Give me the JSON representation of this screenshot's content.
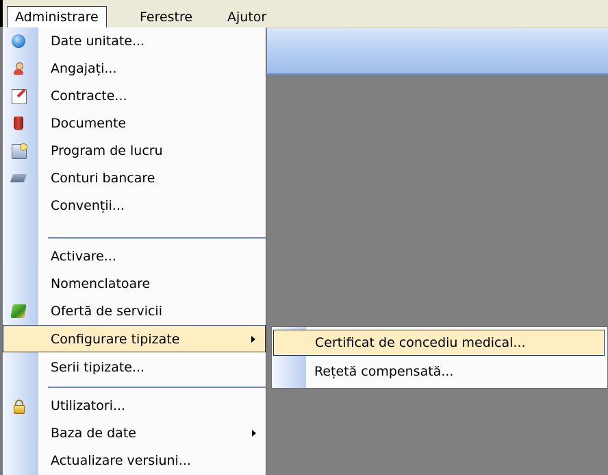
{
  "menubar": {
    "items": [
      {
        "label": "Administrare"
      },
      {
        "label": "Ferestre"
      },
      {
        "label": "Ajutor"
      }
    ]
  },
  "admin_menu": {
    "items": [
      {
        "label": "Date unitate...",
        "icon": "globe-icon"
      },
      {
        "label": "Angajați...",
        "icon": "person-icon"
      },
      {
        "label": "Contracte...",
        "icon": "contract-icon"
      },
      {
        "label": "Documente",
        "icon": "document-icon"
      },
      {
        "label": "Program de lucru",
        "icon": "schedule-icon"
      },
      {
        "label": "Conturi bancare",
        "icon": "bank-card-icon"
      },
      {
        "label": "Convenții...",
        "icon": ""
      },
      {
        "label": "Activare...",
        "icon": ""
      },
      {
        "label": "Nomenclatoare",
        "icon": ""
      },
      {
        "label": "Ofertă de servicii",
        "icon": "services-icon"
      },
      {
        "label": "Configurare tipizate",
        "icon": "",
        "submenu": true,
        "highlighted": true
      },
      {
        "label": "Serii tipizate...",
        "icon": ""
      },
      {
        "label": "Utilizatori...",
        "icon": "lock-icon"
      },
      {
        "label": "Baza de date",
        "icon": "",
        "submenu": true
      },
      {
        "label": "Actualizare versiuni...",
        "icon": ""
      }
    ]
  },
  "submenu": {
    "items": [
      {
        "label": "Certificat de concediu medical...",
        "highlighted": true
      },
      {
        "label": "Rețetă compensată..."
      }
    ]
  },
  "colors": {
    "highlight": "#ffeec2",
    "highlight_border": "#1b2d66",
    "workspace": "#808080",
    "menubar": "#ece9d8"
  }
}
